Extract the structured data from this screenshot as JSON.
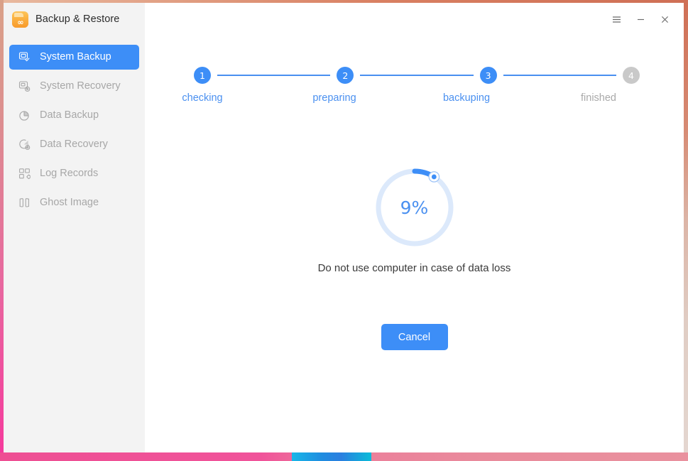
{
  "window": {
    "app_title": "Backup & Restore",
    "logo_icon": "backup-box-icon",
    "logo_glyph": "∞",
    "controls": {
      "menu_label": "menu-icon",
      "minimize_label": "minimize-icon",
      "close_label": "close-icon"
    }
  },
  "sidebar": {
    "items": [
      {
        "label": "System Backup",
        "icon": "system-backup-icon",
        "active": true
      },
      {
        "label": "System Recovery",
        "icon": "system-recovery-icon",
        "active": false
      },
      {
        "label": "Data Backup",
        "icon": "data-backup-icon",
        "active": false
      },
      {
        "label": "Data Recovery",
        "icon": "data-recovery-icon",
        "active": false
      },
      {
        "label": "Log Records",
        "icon": "log-records-icon",
        "active": false
      },
      {
        "label": "Ghost Image",
        "icon": "ghost-image-icon",
        "active": false
      }
    ]
  },
  "main": {
    "stepper": {
      "steps": [
        {
          "number": "1",
          "label": "checking",
          "state": "done"
        },
        {
          "number": "2",
          "label": "preparing",
          "state": "done"
        },
        {
          "number": "3",
          "label": "backuping",
          "state": "current"
        },
        {
          "number": "4",
          "label": "finished",
          "state": "pending"
        }
      ]
    },
    "progress": {
      "percent_label": "9%",
      "percent_value": 9
    },
    "hint_text": "Do not use computer in case of data loss",
    "cancel_label": "Cancel"
  },
  "colors": {
    "accent_blue": "#3d8ef7",
    "step_blue": "#4a90f0",
    "ring_track": "#dce9fb",
    "muted_gray": "#c9c9c9",
    "sidebar_bg": "#f3f3f3",
    "logo_orange": "#f79a2c",
    "frame_pink": "#f5389c"
  }
}
